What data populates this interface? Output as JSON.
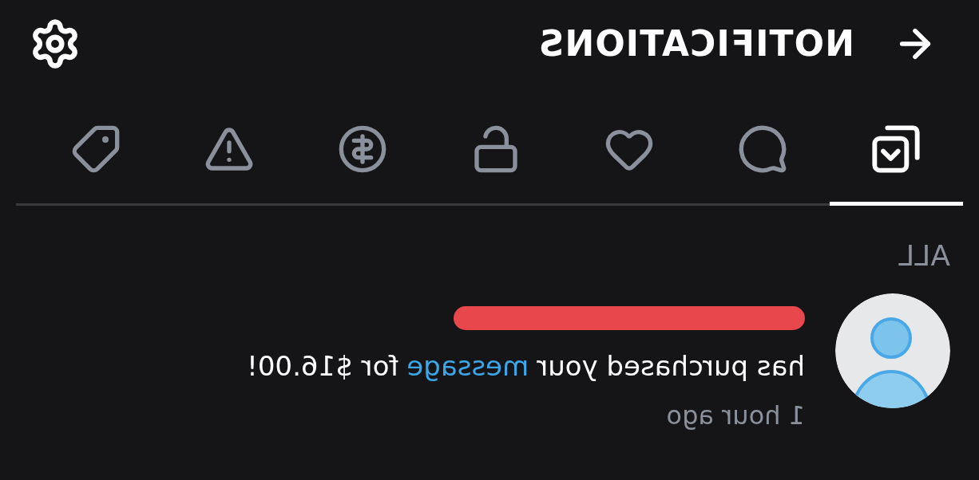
{
  "header": {
    "title": "NOTIFICATIONS"
  },
  "tabs": [
    {
      "kind": "all",
      "selected": true
    },
    {
      "kind": "comments",
      "selected": false
    },
    {
      "kind": "likes",
      "selected": false
    },
    {
      "kind": "subscriptions",
      "selected": false
    },
    {
      "kind": "tips",
      "selected": false
    },
    {
      "kind": "alerts",
      "selected": false
    },
    {
      "kind": "promotions",
      "selected": false
    }
  ],
  "section": {
    "label": "ALL"
  },
  "notifications": [
    {
      "redacted_name": true,
      "text_before": "has purchased your",
      "link": "message",
      "text_after": "for $16.00!",
      "time": "1 hour ago"
    }
  ]
}
